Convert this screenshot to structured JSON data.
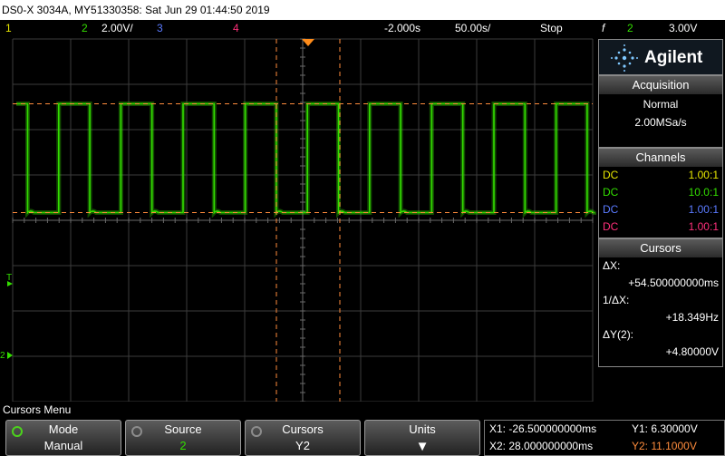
{
  "title_bar": "DS0-X 3034A, MY51330358: Sat Jun 29 01:44:50 2019",
  "status": {
    "ch1_num": "1",
    "ch2_num": "2",
    "ch2_scale": "2.00V/",
    "ch3_num": "3",
    "ch4_num": "4",
    "delay": "-2.000s",
    "timebase": "50.00s/",
    "run_state": "Stop",
    "trig_symbol": "f",
    "trig_source": "2",
    "trig_level": "3.00V"
  },
  "brand": "Agilent",
  "acquisition": {
    "header": "Acquisition",
    "mode": "Normal",
    "rate": "2.00MSa/s"
  },
  "channels": {
    "header": "Channels",
    "rows": [
      {
        "coupling": "DC",
        "probe": "1.00:1",
        "color": "#e6e600"
      },
      {
        "coupling": "DC",
        "probe": "10.0:1",
        "color": "#33dd00"
      },
      {
        "coupling": "DC",
        "probe": "1.00:1",
        "color": "#5a7aff"
      },
      {
        "coupling": "DC",
        "probe": "1.00:1",
        "color": "#ff2f7a"
      }
    ]
  },
  "cursors": {
    "header": "Cursors",
    "dx_label": "ΔX:",
    "dx_value": "+54.500000000ms",
    "inv_dx_label": "1/ΔX:",
    "inv_dx_value": "+18.349Hz",
    "dy_label": "ΔY(2):",
    "dy_value": "+4.80000V"
  },
  "menu": {
    "title": "Cursors Menu",
    "mode_label": "Mode",
    "mode_value": "Manual",
    "source_label": "Source",
    "source_value": "2",
    "cursors_label": "Cursors",
    "cursors_value": "Y2",
    "units_label": "Units",
    "units_arrow": "▼"
  },
  "readout": {
    "x1": "X1: -26.500000000ms",
    "x2": "X2: 28.000000000ms",
    "y1": "Y1: 6.30000V",
    "y2": "Y2: 11.1000V"
  },
  "markers": {
    "trigger": "T",
    "ground": "2"
  },
  "colors": {
    "ch1": "#e6e600",
    "ch2": "#33dd00",
    "ch3": "#5a7aff",
    "ch4": "#ff2f7a",
    "cursor": "#ff8c3c",
    "grid": "#3c3c3c",
    "y2_text": "#ff8c3c"
  },
  "waveform": {
    "type": "square",
    "high_level": 11.1,
    "low_level": 6.3,
    "period_ms": 54.5
  }
}
